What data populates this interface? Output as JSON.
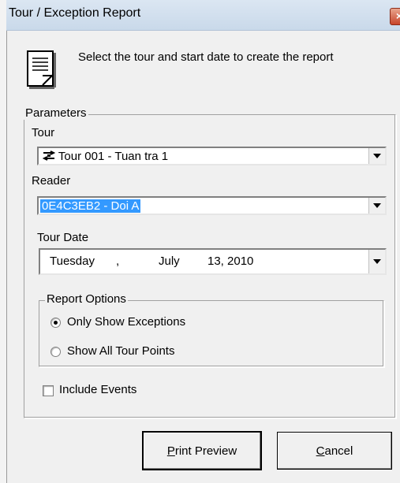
{
  "window": {
    "title": "Tour / Exception Report",
    "close_glyph": "×"
  },
  "intro": {
    "text": "Select the tour and start date to create the report",
    "icon": "report-document-icon"
  },
  "parameters": {
    "legend": "Parameters",
    "tour": {
      "label": "Tour",
      "value": "Tour 001 - Tuan tra 1",
      "icon": "tour-route-icon"
    },
    "reader": {
      "label": "Reader",
      "value": "0E4C3EB2 - Doi A"
    },
    "tour_date": {
      "label": "Tour Date",
      "weekday": "Tuesday",
      "comma": ",",
      "month": "July",
      "day_year": "13, 2010"
    },
    "report_options": {
      "legend": "Report Options",
      "only_exceptions": {
        "label": "Only Show Exceptions",
        "checked": true
      },
      "all_points": {
        "label": "Show All Tour Points",
        "checked": false
      }
    },
    "include_events": {
      "label": "Include Events",
      "checked": false
    }
  },
  "buttons": {
    "print_preview": {
      "mnemonic": "P",
      "rest": "rint Preview"
    },
    "cancel": {
      "mnemonic": "C",
      "rest": "ancel"
    }
  }
}
